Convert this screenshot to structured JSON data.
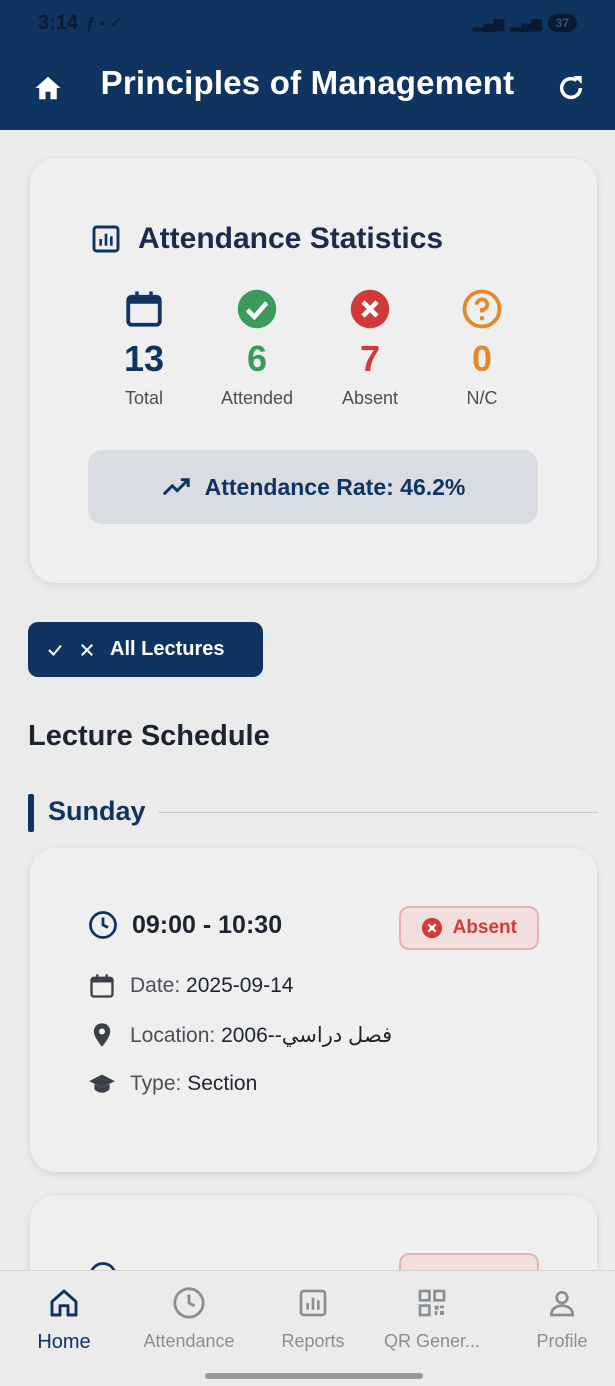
{
  "status_bar": {
    "time": "3:14",
    "battery": "37"
  },
  "app_bar": {
    "title": "Principles of Management"
  },
  "stats": {
    "title": "Attendance Statistics",
    "items": [
      {
        "value": "13",
        "label": "Total",
        "color": "#0f3460",
        "icon": "calendar-icon"
      },
      {
        "value": "6",
        "label": "Attended",
        "color": "#3c9a5a",
        "icon": "check-circle-icon"
      },
      {
        "value": "7",
        "label": "Absent",
        "color": "#d23a3a",
        "icon": "x-circle-icon"
      },
      {
        "value": "0",
        "label": "N/C",
        "color": "#e08a2c",
        "icon": "question-circle-icon"
      }
    ],
    "rate_label": "Attendance Rate: 46.2%"
  },
  "filter": {
    "label": "All Lectures"
  },
  "schedule": {
    "title": "Lecture Schedule",
    "day": "Sunday",
    "lectures": [
      {
        "time": "09:00 - 10:30",
        "status": "Absent",
        "date_key": "Date:",
        "date_value": "2025-09-14",
        "location_key": "Location:",
        "location_value": "2006--فصل دراسي",
        "type_key": "Type:",
        "type_value": "Section"
      }
    ]
  },
  "bottom_nav": {
    "items": [
      {
        "label": "Home",
        "icon": "home-icon"
      },
      {
        "label": "Attendance",
        "icon": "clock-icon"
      },
      {
        "label": "Reports",
        "icon": "chart-icon"
      },
      {
        "label": "QR Gener...",
        "icon": "qr-code-icon"
      },
      {
        "label": "Profile",
        "icon": "person-icon"
      }
    ]
  },
  "colors": {
    "primary": "#0f3460",
    "absent": "#d23a3a",
    "attended": "#3c9a5a",
    "nc": "#e08a2c"
  }
}
